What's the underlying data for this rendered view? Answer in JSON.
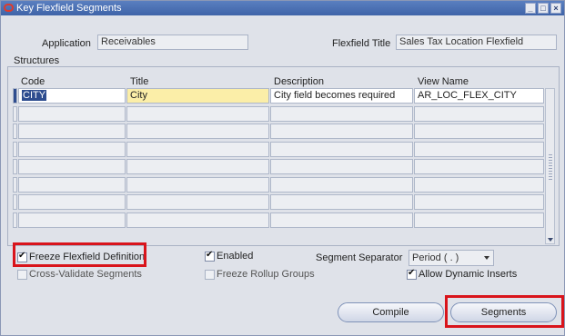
{
  "window": {
    "title": "Key Flexfield Segments",
    "controls": [
      "_",
      "□",
      "×"
    ]
  },
  "header": {
    "application_label": "Application",
    "application_value": "Receivables",
    "flexfield_title_label": "Flexfield Title",
    "flexfield_title_value": "Sales Tax Location Flexfield"
  },
  "structures": {
    "group_label": "Structures",
    "columns": [
      "Code",
      "Title",
      "Description",
      "View Name"
    ],
    "rows": [
      {
        "code": "CITY",
        "title": "City",
        "description": "City field becomes required",
        "view_name": "AR_LOC_FLEX_CITY"
      },
      {
        "code": "",
        "title": "",
        "description": "",
        "view_name": ""
      },
      {
        "code": "",
        "title": "",
        "description": "",
        "view_name": ""
      },
      {
        "code": "",
        "title": "",
        "description": "",
        "view_name": ""
      },
      {
        "code": "",
        "title": "",
        "description": "",
        "view_name": ""
      },
      {
        "code": "",
        "title": "",
        "description": "",
        "view_name": ""
      },
      {
        "code": "",
        "title": "",
        "description": "",
        "view_name": ""
      },
      {
        "code": "",
        "title": "",
        "description": "",
        "view_name": ""
      }
    ]
  },
  "options": {
    "freeze_flexfield": {
      "label": "Freeze Flexfield Definition",
      "checked": true
    },
    "cross_validate": {
      "label": "Cross-Validate Segments",
      "checked": false
    },
    "enabled": {
      "label": "Enabled",
      "checked": true
    },
    "freeze_rollup": {
      "label": "Freeze Rollup Groups",
      "checked": false
    },
    "segment_separator_label": "Segment Separator",
    "segment_separator_value": "Period ( . )",
    "allow_dynamic_inserts": {
      "label": "Allow Dynamic Inserts",
      "checked": true
    }
  },
  "buttons": {
    "compile": "Compile",
    "segments": "Segments"
  },
  "colors": {
    "titlebar": "#4a6fb4",
    "highlight": "#d9141b",
    "selected_field": "#fbeea8"
  }
}
